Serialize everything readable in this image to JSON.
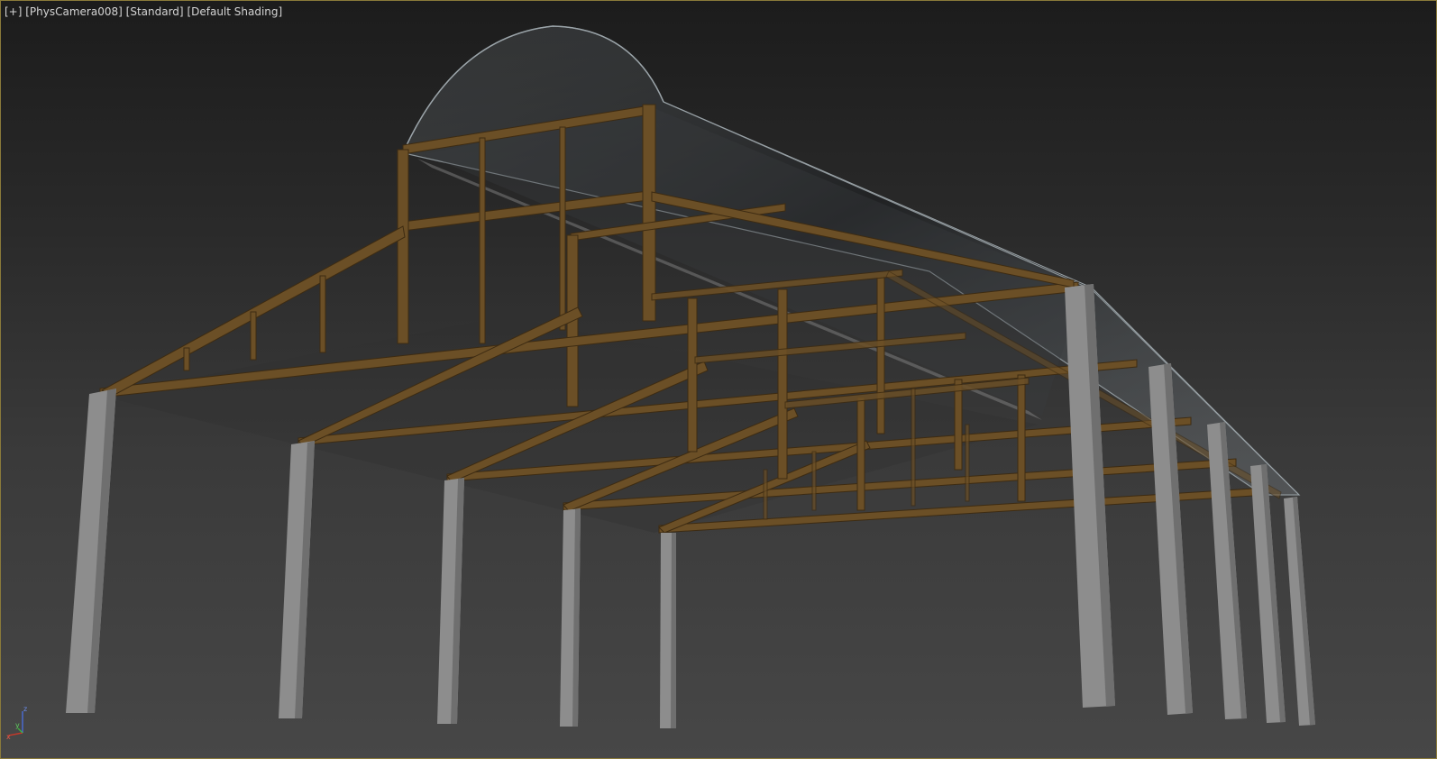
{
  "viewport": {
    "menu_label": "[+]",
    "camera_label": "[PhysCamera008]",
    "mode_label": "[Standard]",
    "shading_label": "[Default Shading]"
  },
  "gizmo": {
    "z_label": "z",
    "y_label": "y",
    "x_label": "x",
    "colors": {
      "x": "#c0392b",
      "y": "#3fae3f",
      "z": "#4a6bd8"
    }
  },
  "scene": {
    "object_names": [
      "steel-frame",
      "concrete-columns",
      "glass-vault-roof"
    ],
    "colors": {
      "frame": "#6b4f26",
      "frame_edge": "#3d2b12",
      "column": "#8d8d8d",
      "column_shade": "#6f6f6f",
      "glass": "#9aa3a8"
    }
  }
}
